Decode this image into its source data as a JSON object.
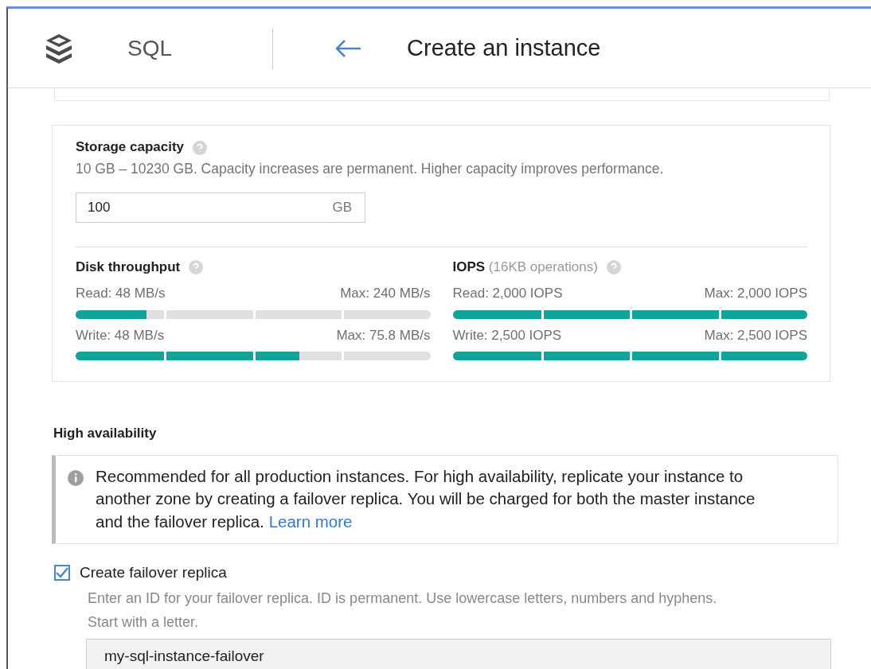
{
  "header": {
    "product": "SQL",
    "title": "Create an instance"
  },
  "storage": {
    "label": "Storage capacity",
    "hint": "10 GB – 10230 GB. Capacity increases are permanent. Higher capacity improves performance.",
    "value": "100",
    "unit": "GB"
  },
  "throughput": {
    "label": "Disk throughput",
    "meters": [
      {
        "reading": "Read: 48 MB/s",
        "max": "Max: 240 MB/s",
        "level": 0.2
      },
      {
        "reading": "Write: 48 MB/s",
        "max": "Max: 75.8 MB/s",
        "level": 0.63
      }
    ]
  },
  "iops": {
    "label": "IOPS",
    "note": "(16KB operations)",
    "meters": [
      {
        "reading": "Read: 2,000 IOPS",
        "max": "Max: 2,000 IOPS",
        "level": 1
      },
      {
        "reading": "Write: 2,500 IOPS",
        "max": "Max: 2,500 IOPS",
        "level": 1
      }
    ]
  },
  "high_availability": {
    "heading": "High availability",
    "info": "Recommended for all production instances. For high availability, replicate your instance to another zone by creating a failover replica. You will be charged for both the master instance and the failover replica.",
    "link": "Learn more",
    "replica": {
      "label": "Create failover replica",
      "checked": true,
      "hint": "Enter an ID for your failover replica. ID is permanent. Use lowercase letters, numbers and hyphens. Start with a letter.",
      "value": "my-sql-instance-failover"
    }
  }
}
